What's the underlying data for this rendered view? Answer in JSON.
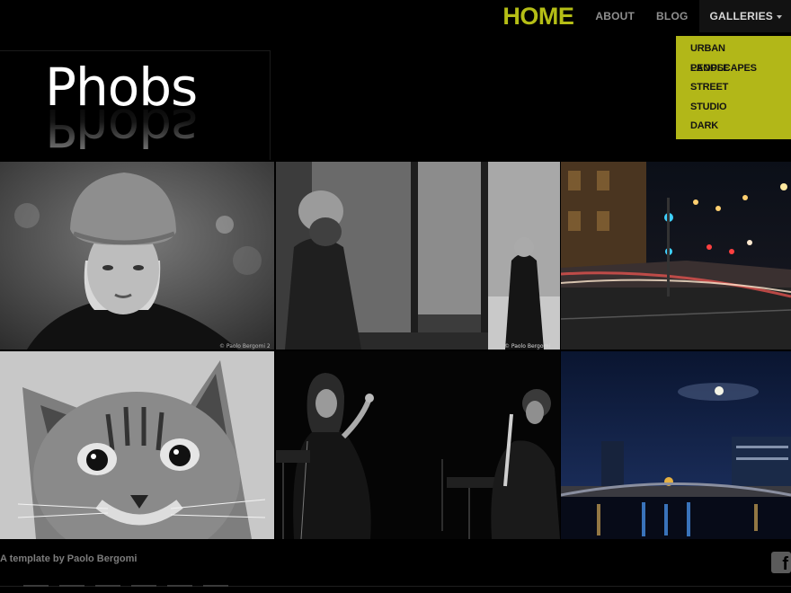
{
  "nav": {
    "home": "HOME",
    "about": "ABOUT",
    "blog": "BLOG",
    "galleries": "GALLERIES"
  },
  "dropdown": [
    {
      "label": "URBAN LANDSCAPES"
    },
    {
      "label": "PEOPLE"
    },
    {
      "label": "STREET"
    },
    {
      "label": "STUDIO"
    },
    {
      "label": "DARK"
    }
  ],
  "logo": {
    "text": "Phobs"
  },
  "photo_credits": {
    "portrait": "© Paolo Bergomi 2",
    "street": "© Paolo Bergomi"
  },
  "footer": {
    "credit": "A template by Paolo Bergomi",
    "social_icon": "facebook-icon"
  },
  "colors": {
    "accent": "#b5be16",
    "dropdown_bg": "#b2b718",
    "background": "#000000"
  }
}
